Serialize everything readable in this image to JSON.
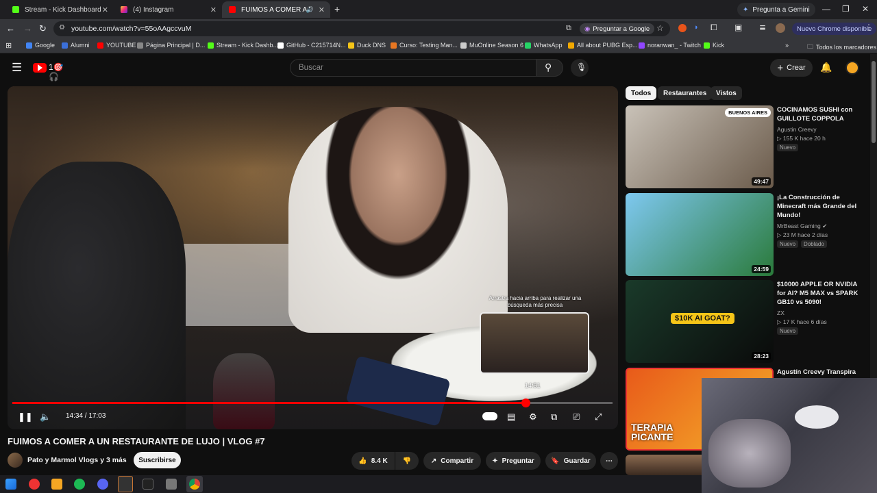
{
  "browser": {
    "tabs": [
      {
        "label": "Stream - Kick Dashboard",
        "icon": "kick-icon"
      },
      {
        "label": "(4) Instagram",
        "icon": "instagram-icon"
      },
      {
        "label": "FUIMOS A COMER A UN RE",
        "icon": "youtube-icon"
      }
    ],
    "new_tab": "+",
    "gemini_label": "Pregunta a Gemini",
    "url": "youtube.com/watch?v=55oAAgccvuM",
    "preguntar_google": "Preguntar a Google",
    "nuevo_chrome": "Nuevo Chrome disponible",
    "bookmarks": [
      {
        "label": "Google",
        "color": "#4285f4"
      },
      {
        "label": "Alumni",
        "color": "#3b6fd8"
      },
      {
        "label": "YOUTUBE",
        "color": "#ff0000"
      },
      {
        "label": "Página Principal | D...",
        "color": "#888888"
      },
      {
        "label": "Stream - Kick Dashb...",
        "color": "#53fc18"
      },
      {
        "label": "GitHub - C215714N...",
        "color": "#ffffff"
      },
      {
        "label": "Duck DNS",
        "color": "#f5c518"
      },
      {
        "label": "Curso: Testing Man...",
        "color": "#e87722"
      },
      {
        "label": "MuOnline Season 6",
        "color": "#cccccc"
      },
      {
        "label": "WhatsApp",
        "color": "#25d366"
      },
      {
        "label": "All about PUBG Esp...",
        "color": "#f2a900"
      },
      {
        "label": "noranwan_ - Twitch",
        "color": "#9146ff"
      },
      {
        "label": "Kick",
        "color": "#53fc18"
      }
    ],
    "bookmarks_more": "»",
    "all_bookmarks": "Todos los marcadores"
  },
  "youtube": {
    "search_placeholder": "Buscar",
    "create_label": "Crear",
    "player": {
      "scrub_hint": "Arrastra hacia arriba para realizar una búsqueda más precisa",
      "scrub_time": "14:51",
      "timecode": "14:34 / 17:03",
      "progress_fraction": 0.855
    },
    "video": {
      "title": "FUIMOS A COMER A UN RESTAURANTE DE LUJO | VLOG #7",
      "channel": "Pato y Marmol Vlogs y 3 más",
      "subscribe": "Suscribirse",
      "likes": "8.4 K",
      "share": "Compartir",
      "ask": "Preguntar",
      "save": "Guardar"
    },
    "chips": [
      "Todos",
      "Restaurantes",
      "Vistos"
    ],
    "recommendations": [
      {
        "title": "COCINAMOS SUSHI con GUILLOTE COPPOLA",
        "channel": "Agustin Creevy",
        "meta": "▷ 155 K  hace 20 h",
        "badges": [
          "Nuevo"
        ],
        "duration": "49:47",
        "overlay": "BUENOS AIRES",
        "color1": "#c9c2b8",
        "color2": "#6a5a4a"
      },
      {
        "title": "¡La Construcción de Minecraft más Grande del Mundo!",
        "channel": "MrBeast Gaming",
        "meta": "▷ 23 M  hace 2 días",
        "badges": [
          "Nuevo",
          "Doblado"
        ],
        "duration": "24:59",
        "color1": "#7ec8f0",
        "color2": "#2a7a3a"
      },
      {
        "title": "$10000 APPLE OR NVIDIA for AI? M5 MAX vs SPARK GB10 vs 5090!",
        "channel": "ZX",
        "meta": "▷ 17 K  hace 6 días",
        "badges": [
          "Nuevo"
        ],
        "duration": "28:23",
        "overlay": "$10K AI GOAT?",
        "color1": "#1a3a2a",
        "color2": "#0a0a0a"
      },
      {
        "title": "Agustín Creevy Transpira",
        "channel": "",
        "meta": "",
        "badges": [],
        "duration": "",
        "overlay": "TERAPIA PICANTE",
        "color1": "#e85a1a",
        "color2": "#f5b02a"
      }
    ]
  }
}
